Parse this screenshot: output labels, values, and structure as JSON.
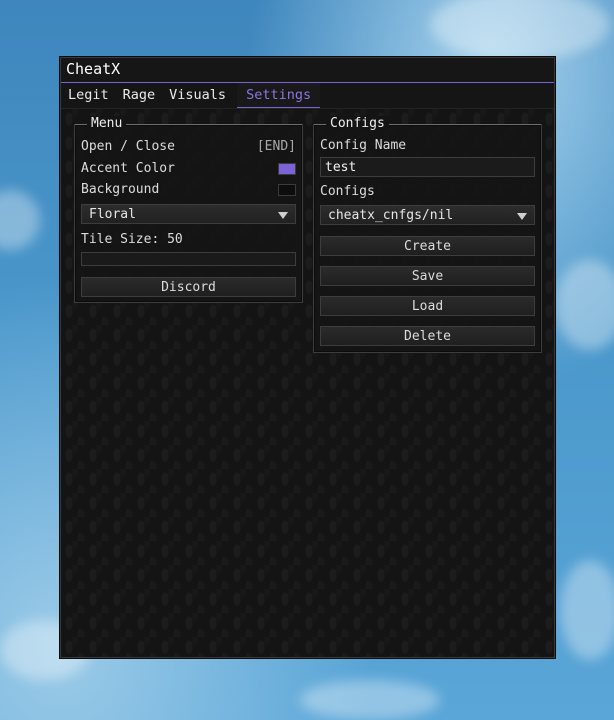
{
  "app": {
    "title": "CheatX"
  },
  "tabs": [
    {
      "label": "Legit"
    },
    {
      "label": "Rage"
    },
    {
      "label": "Visuals"
    },
    {
      "label": "Settings",
      "active": true
    }
  ],
  "menu_group": {
    "title": "Menu",
    "open_close": {
      "label": "Open / Close",
      "key": "[END]"
    },
    "accent_color": {
      "label": "Accent Color",
      "color": "#7b62d6"
    },
    "background": {
      "label": "Background",
      "color": "#0d0d0d"
    },
    "pattern_dropdown": {
      "value": "Floral"
    },
    "tile_size": {
      "label": "Tile Size: 50",
      "value": 50
    },
    "discord_label": "Discord"
  },
  "configs_group": {
    "title": "Configs",
    "config_name_label": "Config Name",
    "config_name_value": "test",
    "configs_label": "Configs",
    "configs_dropdown_value": "cheatx_cnfgs/nil",
    "buttons": {
      "create": "Create",
      "save": "Save",
      "load": "Load",
      "delete": "Delete"
    }
  },
  "colors": {
    "accent": "#7b62d6",
    "active_tab_text": "#8b76e2"
  }
}
